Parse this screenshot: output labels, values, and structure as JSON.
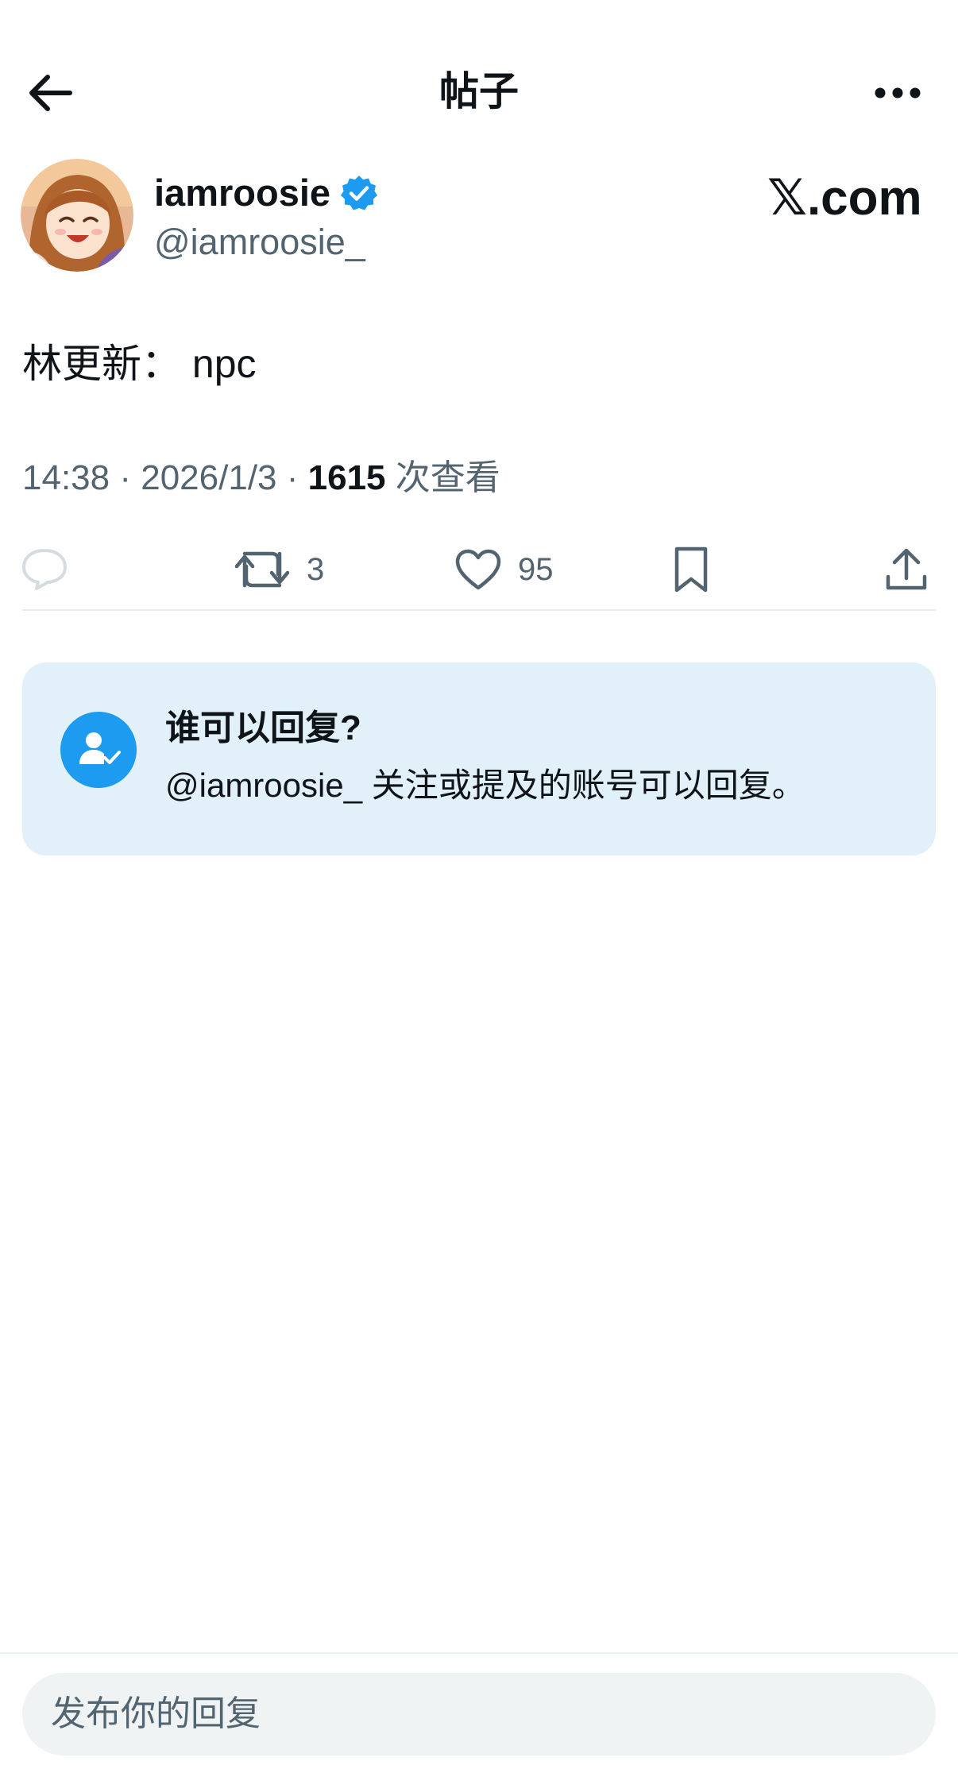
{
  "header": {
    "title": "帖子"
  },
  "author": {
    "display_name": "iamroosie",
    "handle": "@iamroosie_",
    "verified": true
  },
  "watermark": "𝕏.com",
  "post": {
    "text": "林更新： npc",
    "time": "14:38",
    "date": "2026/1/3",
    "separator": "·",
    "views_count": "1615",
    "views_label": "次查看"
  },
  "actions": {
    "reply_count": "",
    "retweet_count": "3",
    "like_count": "95"
  },
  "reply_restriction": {
    "title": "谁可以回复?",
    "description": "@iamroosie_ 关注或提及的账号可以回复。"
  },
  "composer": {
    "placeholder": "发布你的回复"
  },
  "colors": {
    "accent": "#1d9bf0",
    "muted": "#536471",
    "card_bg": "#e1f0f9"
  }
}
